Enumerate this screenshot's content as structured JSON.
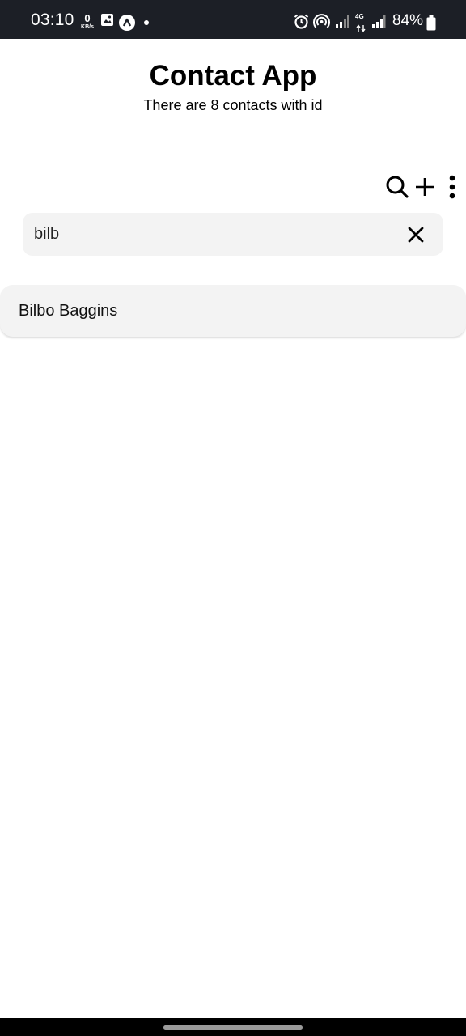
{
  "status_bar": {
    "time": "03:10",
    "net_speed_value": "0",
    "net_speed_unit": "KB/s",
    "network_type": "4G",
    "battery": "84%",
    "icons": [
      "image-icon",
      "app-icon",
      "alarm-icon",
      "hotspot-icon",
      "signal-icon",
      "battery-icon"
    ]
  },
  "header": {
    "title": "Contact App",
    "subtitle": "There are 8 contacts with id"
  },
  "toolbar": {
    "icons": [
      "search-icon",
      "add-icon",
      "more-vert-icon"
    ]
  },
  "search": {
    "value": "bilb"
  },
  "contacts": [
    {
      "name": "Bilbo Baggins"
    }
  ],
  "colors": {
    "status_bar_bg": "#1c1f26",
    "surface": "#f3f3f3",
    "text": "#000000"
  }
}
